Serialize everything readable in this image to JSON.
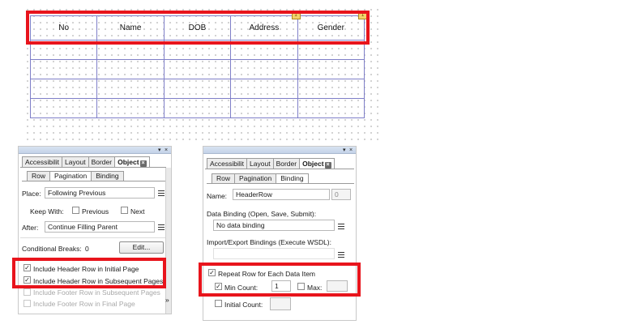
{
  "table": {
    "headers": [
      "No",
      "Name",
      "DOB",
      "Address",
      "Gender"
    ],
    "body_rows": 4
  },
  "left_panel": {
    "title_controls": {
      "menu": "▾",
      "close": "×"
    },
    "tabs": [
      "Accessibilit",
      "Layout",
      "Border",
      "Object"
    ],
    "subtabs": [
      "Row",
      "Pagination",
      "Binding"
    ],
    "place_label": "Place:",
    "place_value": "Following Previous",
    "keep_with_label": "Keep With:",
    "previous_label": "Previous",
    "next_label": "Next",
    "after_label": "After:",
    "after_value": "Continue Filling Parent",
    "conditional_breaks_label": "Conditional Breaks:",
    "conditional_breaks_count": "0",
    "edit_button": "Edit...",
    "include_header_initial": "Include Header Row in Initial Page",
    "include_header_subsequent": "Include Header Row in Subsequent Pages",
    "include_footer_subsequent": "Include Footer Row in Subsequent Pages",
    "include_footer_final": "Include Footer Row in Final Page",
    "more_arrow": "»"
  },
  "right_panel": {
    "title_controls": {
      "menu": "▾",
      "close": "×"
    },
    "tabs": [
      "Accessibilit",
      "Layout",
      "Border",
      "Object"
    ],
    "subtabs": [
      "Row",
      "Pagination",
      "Binding"
    ],
    "name_label": "Name:",
    "name_value": "HeaderRow",
    "name_index": "0",
    "data_binding_label": "Data Binding (Open, Save, Submit):",
    "data_binding_value": "No data binding",
    "import_export_label": "Import/Export Bindings (Execute WSDL):",
    "repeat_row_label": "Repeat Row for Each Data Item",
    "min_count_label": "Min Count:",
    "min_count_value": "1",
    "max_label": "Max:",
    "initial_count_label": "Initial Count:"
  }
}
